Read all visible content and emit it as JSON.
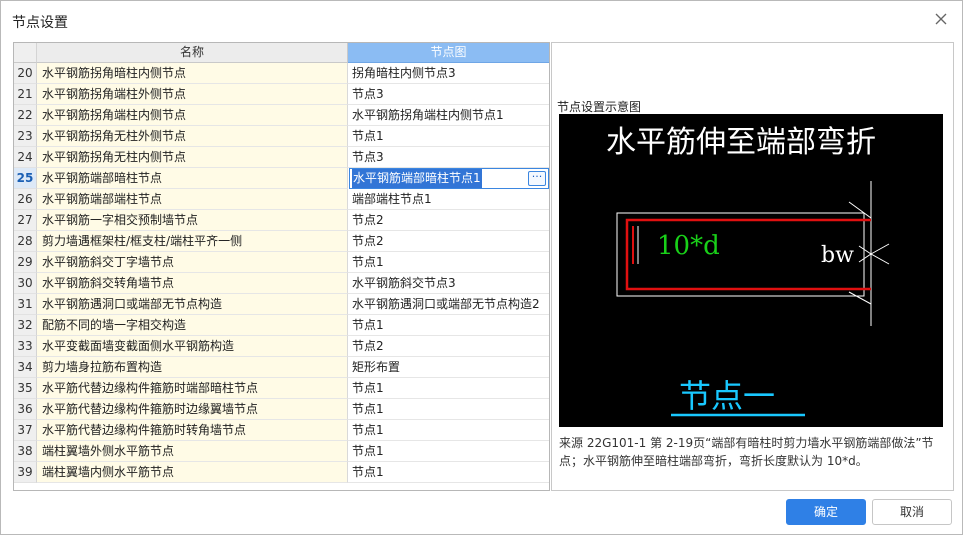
{
  "dialog": {
    "title": "节点设置"
  },
  "table": {
    "headers": {
      "name": "名称",
      "node": "节点图"
    },
    "rows": [
      {
        "num": "20",
        "name": "水平钢筋拐角暗柱内侧节点",
        "node": "拐角暗柱内侧节点3"
      },
      {
        "num": "21",
        "name": "水平钢筋拐角端柱外侧节点",
        "node": "节点3"
      },
      {
        "num": "22",
        "name": "水平钢筋拐角端柱内侧节点",
        "node": "水平钢筋拐角端柱内侧节点1"
      },
      {
        "num": "23",
        "name": "水平钢筋拐角无柱外侧节点",
        "node": "节点1"
      },
      {
        "num": "24",
        "name": "水平钢筋拐角无柱内侧节点",
        "node": "节点3"
      },
      {
        "num": "25",
        "name": "水平钢筋端部暗柱节点",
        "node": "水平钢筋端部暗柱节点1",
        "selected": true
      },
      {
        "num": "26",
        "name": "水平钢筋端部端柱节点",
        "node": "端部端柱节点1"
      },
      {
        "num": "27",
        "name": "水平钢筋一字相交预制墙节点",
        "node": "节点2"
      },
      {
        "num": "28",
        "name": "剪力墙遇框架柱/框支柱/端柱平齐一侧",
        "node": "节点2"
      },
      {
        "num": "29",
        "name": "水平钢筋斜交丁字墙节点",
        "node": "节点1"
      },
      {
        "num": "30",
        "name": "水平钢筋斜交转角墙节点",
        "node": "水平钢筋斜交节点3"
      },
      {
        "num": "31",
        "name": "水平钢筋遇洞口或端部无节点构造",
        "node": "水平钢筋遇洞口或端部无节点构造2"
      },
      {
        "num": "32",
        "name": "配筋不同的墙一字相交构造",
        "node": "节点1"
      },
      {
        "num": "33",
        "name": "水平变截面墙变截面侧水平钢筋构造",
        "node": "节点2"
      },
      {
        "num": "34",
        "name": "剪力墙身拉筋布置构造",
        "node": "矩形布置"
      },
      {
        "num": "35",
        "name": "水平筋代替边缘构件箍筋时端部暗柱节点",
        "node": "节点1"
      },
      {
        "num": "36",
        "name": "水平筋代替边缘构件箍筋时边缘翼墙节点",
        "node": "节点1"
      },
      {
        "num": "37",
        "name": "水平筋代替边缘构件箍筋时转角墙节点",
        "node": "节点1"
      },
      {
        "num": "38",
        "name": "端柱翼墙外侧水平筋节点",
        "node": "节点1"
      },
      {
        "num": "39",
        "name": "端柱翼墙内侧水平筋节点",
        "node": "节点1"
      }
    ],
    "edit_button": "···"
  },
  "preview": {
    "title": "节点设置示意图",
    "diagram": {
      "heading": "水平筋伸至端部弯折",
      "dim_label": "10*d",
      "bw_label": "bw",
      "caption": "节点一",
      "colors": {
        "rebar": "#e01010",
        "dim": "#19d019",
        "caption": "#19c8ff",
        "line": "#ffffff"
      }
    },
    "description": "来源 22G101-1 第 2-19页“端部有暗柱时剪力墙水平钢筋端部做法”节点；水平钢筋伸至暗柱端部弯折，弯折长度默认为 10*d。"
  },
  "buttons": {
    "ok": "确定",
    "cancel": "取消"
  }
}
